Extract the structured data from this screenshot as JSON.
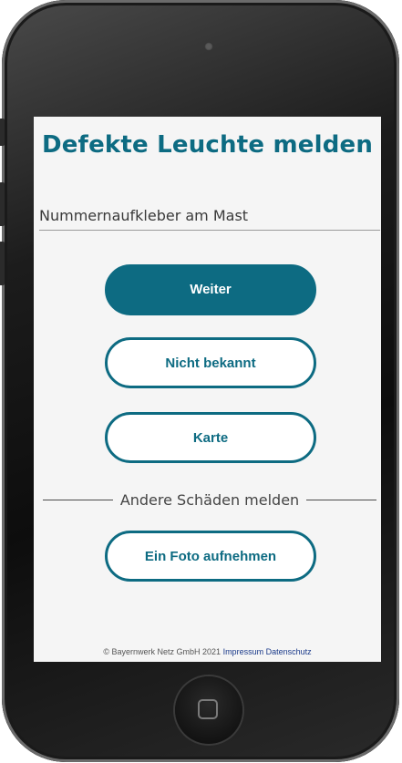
{
  "screen": {
    "title": "Defekte Leuchte melden",
    "input": {
      "placeholder": "Nummernaufkleber am Mast",
      "value": ""
    },
    "buttons": {
      "weiter": "Weiter",
      "nicht_bekannt": "Nicht bekannt",
      "karte": "Karte",
      "foto": "Ein Foto aufnehmen"
    },
    "divider_label": "Andere Schäden melden",
    "footer": {
      "copyright": "© Bayernwerk Netz GmbH 2021",
      "impressum": "Impressum",
      "datenschutz": "Datenschutz"
    }
  },
  "colors": {
    "accent": "#0d6b82",
    "link": "#1a3a8a"
  }
}
